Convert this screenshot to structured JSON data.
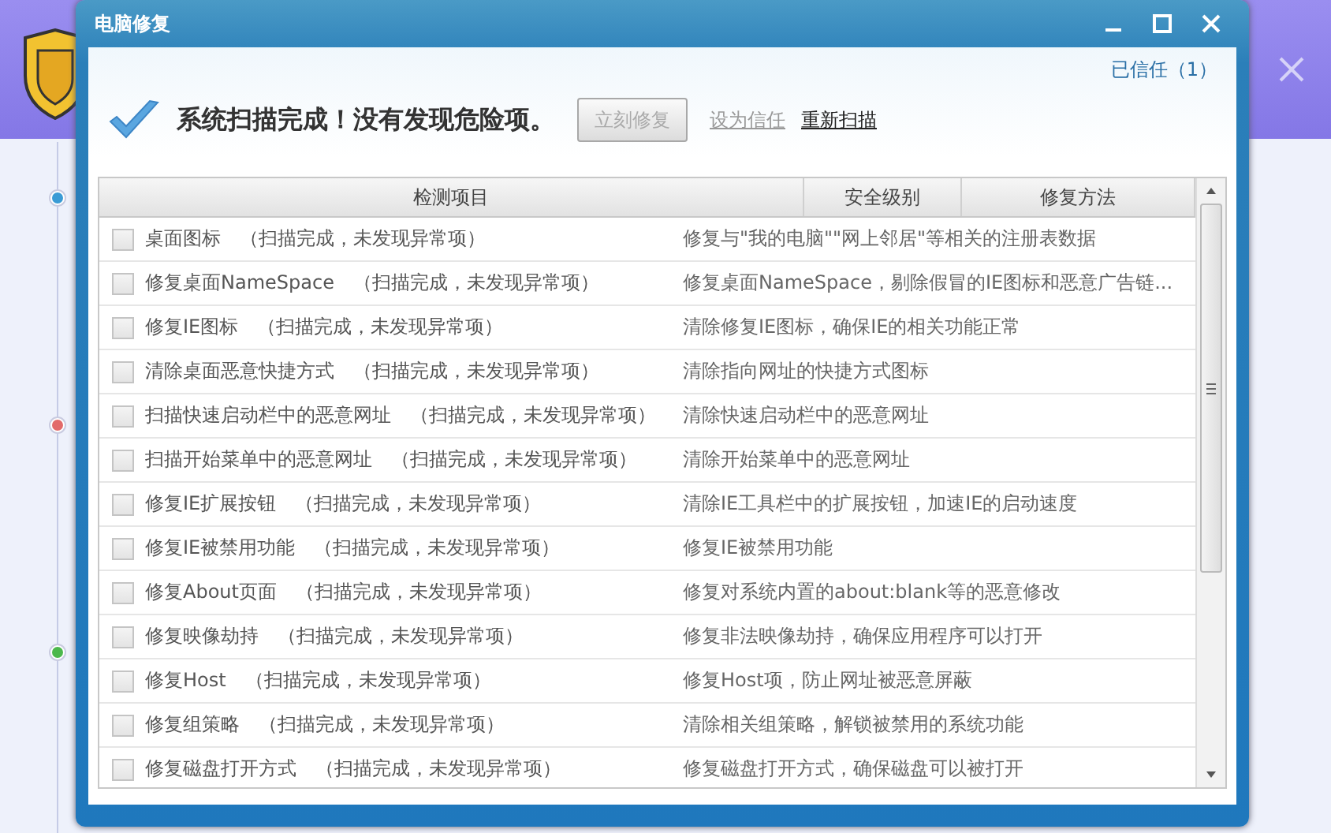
{
  "background_app": {
    "timeline": [
      {
        "color": "#3a9bd5"
      },
      {
        "color": "#e26a6a"
      },
      {
        "color": "#4cb84c"
      }
    ]
  },
  "dialog": {
    "title": "电脑修复",
    "trusted_link": "已信任（1）",
    "status": "系统扫描完成！没有发现危险项。",
    "fix_button": {
      "label": "立刻修复",
      "disabled": true
    },
    "trust_link": {
      "label": "设为信任",
      "disabled": true
    },
    "rescan_link": {
      "label": "重新扫描",
      "disabled": false
    },
    "table": {
      "columns": [
        "检测项目",
        "安全级别",
        "修复方法"
      ],
      "rows": [
        {
          "name": "桌面图标",
          "status": "（扫描完成，未发现异常项）",
          "description": "修复与\"我的电脑\"\"网上邻居\"等相关的注册表数据",
          "checked": false
        },
        {
          "name": "修复桌面NameSpace",
          "status": "（扫描完成，未发现异常项）",
          "description": "修复桌面NameSpace，剔除假冒的IE图标和恶意广告链...",
          "checked": false
        },
        {
          "name": "修复IE图标",
          "status": "（扫描完成，未发现异常项）",
          "description": "清除修复IE图标，确保IE的相关功能正常",
          "checked": false
        },
        {
          "name": "清除桌面恶意快捷方式",
          "status": "（扫描完成，未发现异常项）",
          "description": "清除指向网址的快捷方式图标",
          "checked": false
        },
        {
          "name": "扫描快速启动栏中的恶意网址",
          "status": "（扫描完成，未发现异常项）",
          "description": "清除快速启动栏中的恶意网址",
          "checked": false
        },
        {
          "name": "扫描开始菜单中的恶意网址",
          "status": "（扫描完成，未发现异常项）",
          "description": "清除开始菜单中的恶意网址",
          "checked": false
        },
        {
          "name": "修复IE扩展按钮",
          "status": "（扫描完成，未发现异常项）",
          "description": "清除IE工具栏中的扩展按钮，加速IE的启动速度",
          "checked": false
        },
        {
          "name": "修复IE被禁用功能",
          "status": "（扫描完成，未发现异常项）",
          "description": "修复IE被禁用功能",
          "checked": false
        },
        {
          "name": "修复About页面",
          "status": "（扫描完成，未发现异常项）",
          "description": "修复对系统内置的about:blank等的恶意修改",
          "checked": false
        },
        {
          "name": "修复映像劫持",
          "status": "（扫描完成，未发现异常项）",
          "description": "修复非法映像劫持，确保应用程序可以打开",
          "checked": false
        },
        {
          "name": "修复Host",
          "status": "（扫描完成，未发现异常项）",
          "description": "修复Host项，防止网址被恶意屏蔽",
          "checked": false
        },
        {
          "name": "修复组策略",
          "status": "（扫描完成，未发现异常项）",
          "description": "清除相关组策略，解锁被禁用的系统功能",
          "checked": false
        },
        {
          "name": "修复磁盘打开方式",
          "status": "（扫描完成，未发现异常项）",
          "description": "修复磁盘打开方式，确保磁盘可以被打开",
          "checked": false
        }
      ]
    }
  }
}
